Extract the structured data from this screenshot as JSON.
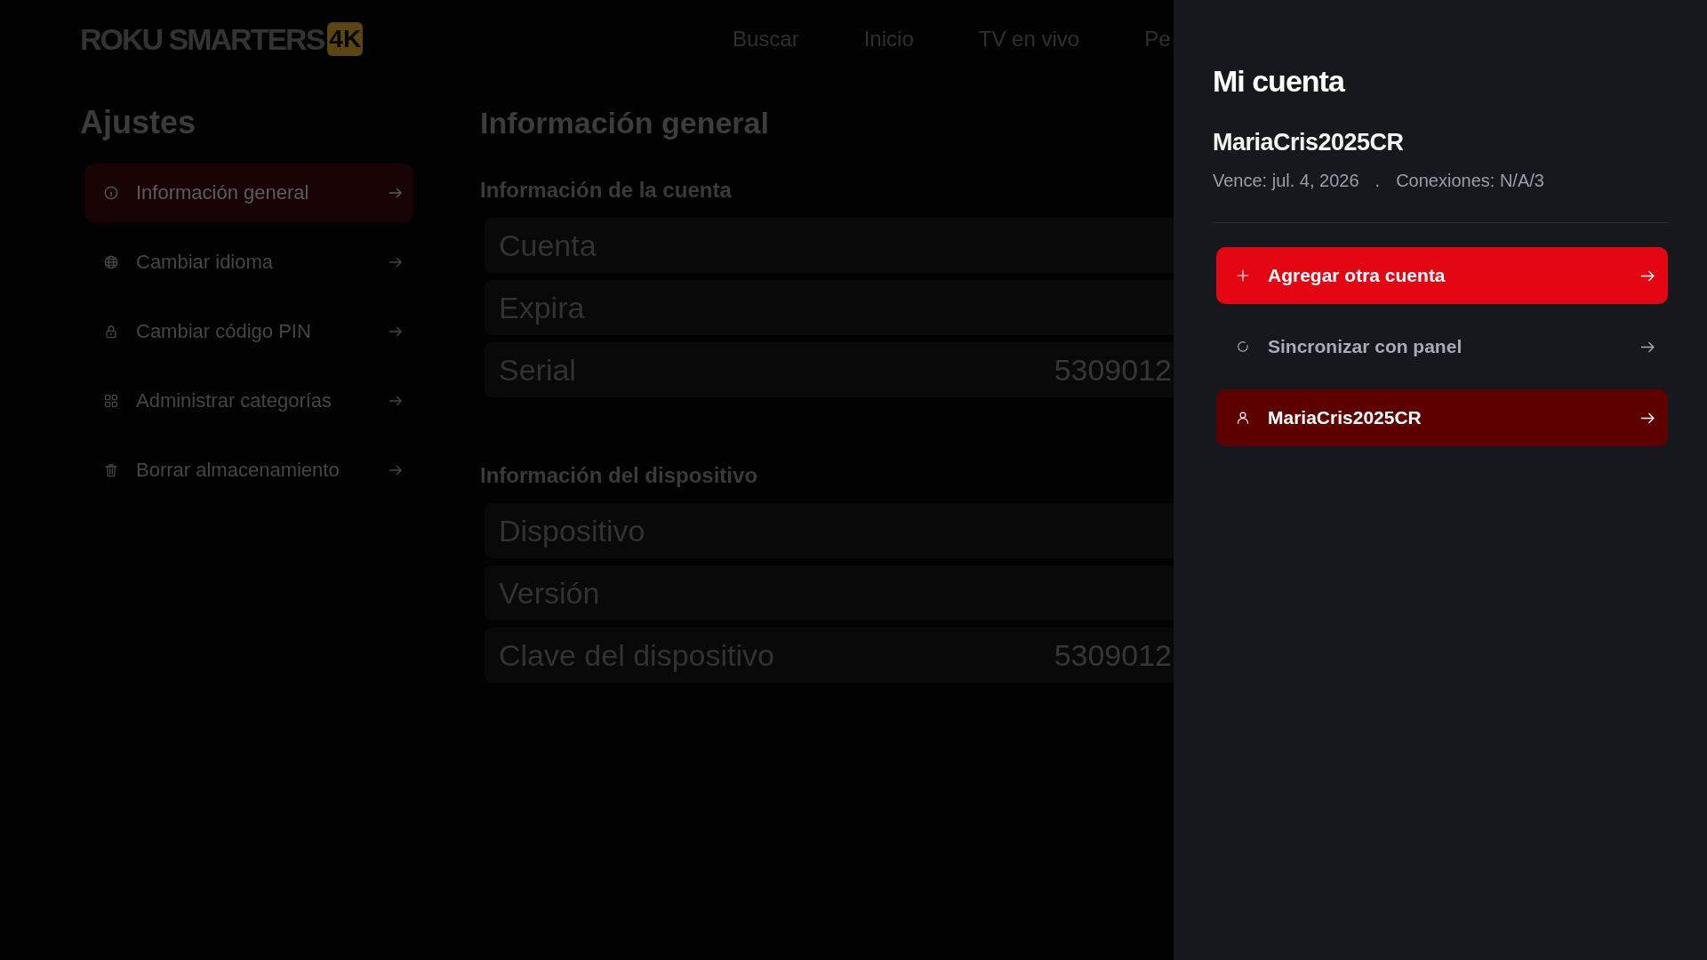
{
  "logo": {
    "text": "ROKU SMARTERS",
    "badge": "4K"
  },
  "nav": [
    {
      "label": "Buscar"
    },
    {
      "label": "Inicio"
    },
    {
      "label": "TV en vivo"
    },
    {
      "label": "Pe"
    }
  ],
  "settings": {
    "title": "Ajustes",
    "items": [
      {
        "kind": "info",
        "label": "Información general",
        "selected": true
      },
      {
        "kind": "language",
        "label": "Cambiar idioma",
        "selected": false
      },
      {
        "kind": "pin",
        "label": "Cambiar código PIN",
        "selected": false
      },
      {
        "kind": "categories",
        "label": "Administrar categorías",
        "selected": false
      },
      {
        "kind": "storage",
        "label": "Borrar almacenamiento",
        "selected": false
      }
    ]
  },
  "content": {
    "title": "Información general",
    "sections": [
      {
        "heading": "Información de la cuenta",
        "rows": [
          {
            "label": "Cuenta"
          },
          {
            "label": "Expira"
          },
          {
            "label": "Serial",
            "value": "5309012"
          }
        ]
      },
      {
        "heading": "Información del dispositivo",
        "rows": [
          {
            "label": "Dispositivo"
          },
          {
            "label": "Versión"
          },
          {
            "label": "Clave del dispositivo",
            "value": "5309012"
          }
        ]
      }
    ]
  },
  "account_panel": {
    "title": "Mi cuenta",
    "username": "MariaCris2025CR",
    "expires": "Vence: jul. 4, 2026",
    "separator": ".",
    "connections": "Conexiones: N/A/3",
    "actions": [
      {
        "kind": "add",
        "label": "Agregar otra cuenta"
      },
      {
        "kind": "sync",
        "label": "Sincronizar con panel"
      },
      {
        "kind": "account",
        "label": "MariaCris2025CR"
      }
    ]
  }
}
